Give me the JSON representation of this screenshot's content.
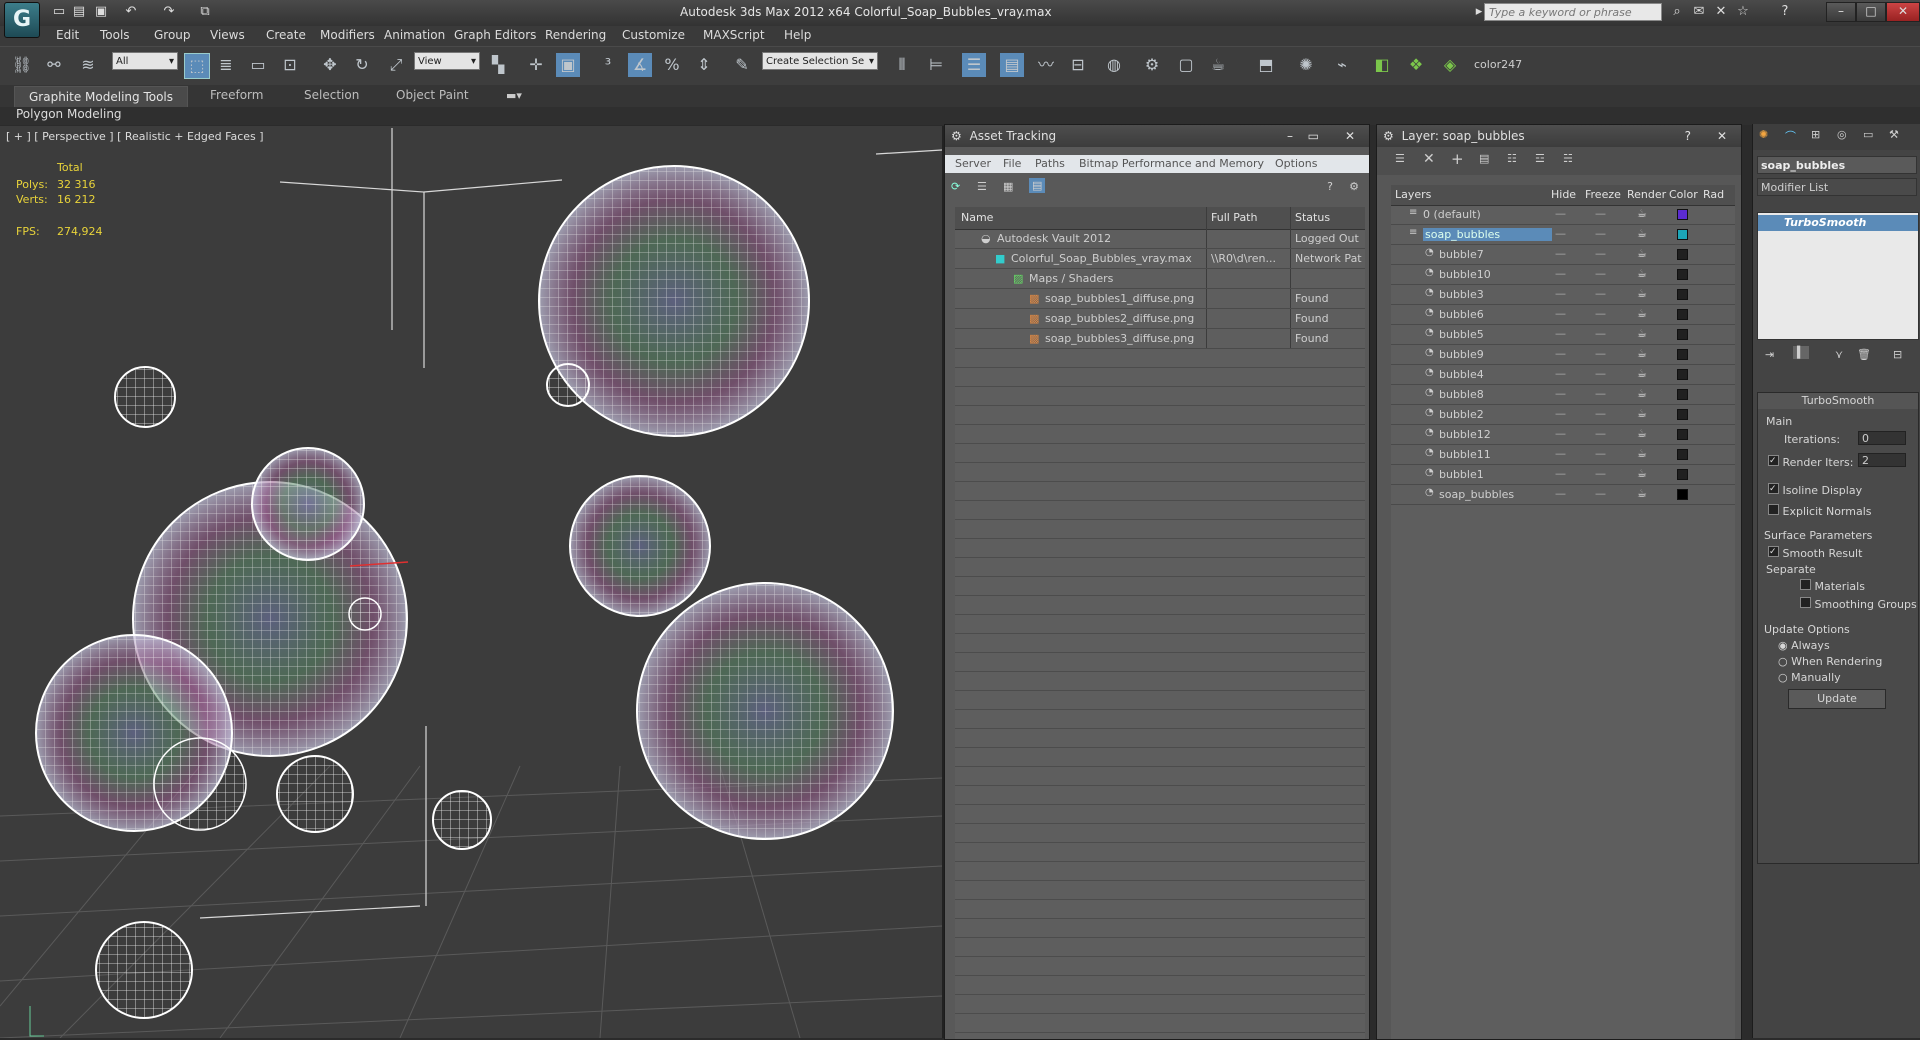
{
  "window": {
    "title": "Autodesk 3ds Max  2012 x64      Colorful_Soap_Bubbles_vray.max",
    "search_placeholder": "Type a keyword or phrase",
    "logo": "3ds-max-logo"
  },
  "menu": [
    "Edit",
    "Tools",
    "Group",
    "Views",
    "Create",
    "Modifiers",
    "Animation",
    "Graph Editors",
    "Rendering",
    "Customize",
    "MAXScript",
    "Help"
  ],
  "toolbar": {
    "selection_filter": "All",
    "ref_coord": "View",
    "named_selection": "Create Selection Se",
    "color_label": "color247"
  },
  "ribbon": {
    "tabs": [
      "Graphite Modeling Tools",
      "Freeform",
      "Selection",
      "Object Paint"
    ],
    "sub_tab": "Polygon Modeling"
  },
  "viewport": {
    "label": "[ + ] [ Perspective ] [ Realistic + Edged Faces ]",
    "stats_header": "Total",
    "polys_label": "Polys:",
    "polys_value": "32 316",
    "verts_label": "Verts:",
    "verts_value": "16 212",
    "fps_label": "FPS:",
    "fps_value": "274,924"
  },
  "asset_tracking": {
    "title": "Asset Tracking",
    "menu": [
      "Server",
      "File",
      "Paths",
      "Bitmap Performance and Memory",
      "Options"
    ],
    "columns": [
      "Name",
      "Full Path",
      "Status"
    ],
    "rows": [
      {
        "name": "Autodesk Vault 2012",
        "path": "",
        "status": "Logged Out"
      },
      {
        "name": "Colorful_Soap_Bubbles_vray.max",
        "path": "\\\\R0\\d\\ren...",
        "status": "Network Pat"
      },
      {
        "name": "Maps / Shaders",
        "path": "",
        "status": ""
      },
      {
        "name": "soap_bubbles1_diffuse.png",
        "path": "",
        "status": "Found"
      },
      {
        "name": "soap_bubbles2_diffuse.png",
        "path": "",
        "status": "Found"
      },
      {
        "name": "soap_bubbles3_diffuse.png",
        "path": "",
        "status": "Found"
      }
    ]
  },
  "layers": {
    "title": "Layer: soap_bubbles",
    "columns": [
      "Layers",
      "Hide",
      "Freeze",
      "Render",
      "Color",
      "Rad"
    ],
    "rows": [
      {
        "name": "0 (default)",
        "color": "#5b2bd1"
      },
      {
        "name": "soap_bubbles",
        "color": "#1ca6b8"
      },
      {
        "name": "bubble7",
        "color": "#202020"
      },
      {
        "name": "bubble10",
        "color": "#202020"
      },
      {
        "name": "bubble3",
        "color": "#202020"
      },
      {
        "name": "bubble6",
        "color": "#202020"
      },
      {
        "name": "bubble5",
        "color": "#202020"
      },
      {
        "name": "bubble9",
        "color": "#202020"
      },
      {
        "name": "bubble4",
        "color": "#202020"
      },
      {
        "name": "bubble8",
        "color": "#202020"
      },
      {
        "name": "bubble2",
        "color": "#202020"
      },
      {
        "name": "bubble12",
        "color": "#202020"
      },
      {
        "name": "bubble11",
        "color": "#202020"
      },
      {
        "name": "bubble1",
        "color": "#202020"
      },
      {
        "name": "soap_bubbles",
        "color": "#000000"
      }
    ]
  },
  "command_panel": {
    "object_name": "soap_bubbles",
    "modifier_list": "Modifier List",
    "stack_item": "TurboSmooth",
    "rollout_title": "TurboSmooth",
    "main_label": "Main",
    "iterations_label": "Iterations:",
    "iterations_value": "0",
    "render_iters_label": "Render Iters:",
    "render_iters_value": "2",
    "isoline_label": "Isoline Display",
    "explicit_label": "Explicit Normals",
    "surface_label": "Surface Parameters",
    "smooth_label": "Smooth Result",
    "separate_label": "Separate",
    "materials_label": "Materials",
    "smoothing_label": "Smoothing Groups",
    "update_options_label": "Update Options",
    "always_label": "Always",
    "when_rendering_label": "When Rendering",
    "manually_label": "Manually",
    "update_button": "Update"
  }
}
